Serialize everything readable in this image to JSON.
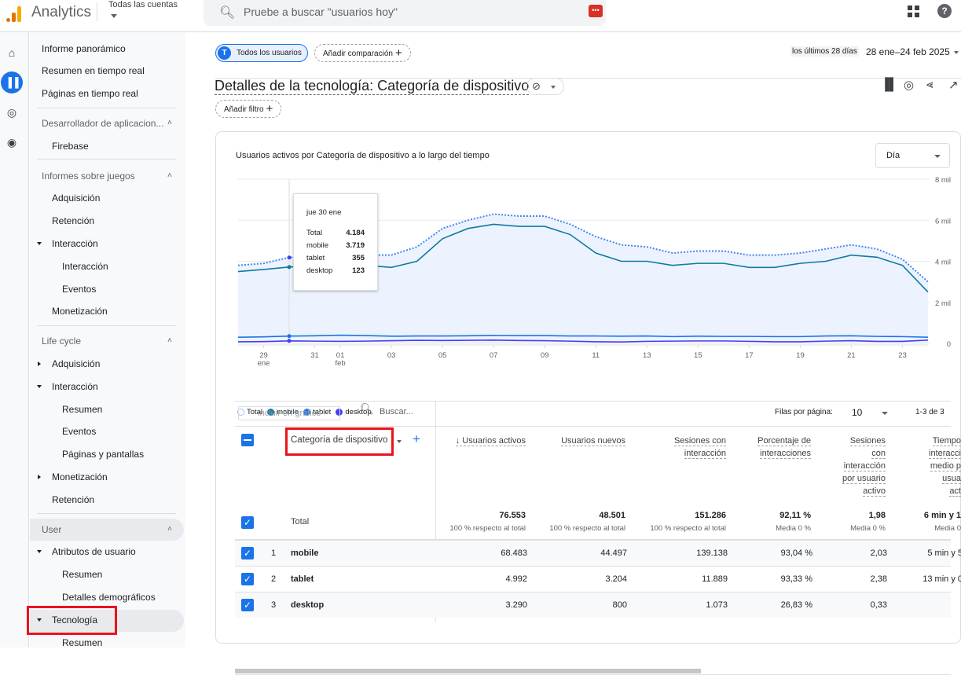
{
  "header": {
    "app_name": "Analytics",
    "account_selector": "Todas las cuentas",
    "search_placeholder": "Pruebe a buscar \"usuarios hoy\"",
    "icons": [
      "analytics-logo-icon",
      "search-icon",
      "keyboard-shortcut-icon",
      "apps-grid-icon",
      "help-icon"
    ]
  },
  "rail": {
    "icons": [
      "home-icon",
      "reports-icon",
      "explore-icon",
      "advertising-icon"
    ]
  },
  "nav": {
    "top_items": [
      "Informe panorámico",
      "Resumen en tiempo real",
      "Páginas en tiempo real"
    ],
    "sections": [
      {
        "title": "Desarrollador de aplicacion...",
        "items": [
          "Firebase"
        ]
      },
      {
        "title": "Informes sobre juegos",
        "items": [
          "Adquisición",
          "Retención",
          "Interacción",
          "Interacción",
          "Eventos",
          "Monetización"
        ]
      },
      {
        "title": "Life cycle",
        "items": [
          "Adquisición",
          "Interacción",
          "Resumen",
          "Eventos",
          "Páginas y pantallas",
          "Monetización",
          "Retención"
        ]
      },
      {
        "title": "User",
        "items": [
          "Atributos de usuario",
          "Resumen",
          "Detalles demográficos",
          "Tecnología",
          "Resumen"
        ]
      }
    ]
  },
  "toolbar": {
    "segment_chip": "Todos los usuarios",
    "segment_avatar": "T",
    "add_comparison": "Añadir comparación",
    "date_label": "los últimos 28 días",
    "date_range": "28 ene–24 feb 2025",
    "page_title": "Detalles de la tecnología: Categoría de dispositivo",
    "add_filter": "Añadir filtro"
  },
  "chart_card": {
    "title": "Usuarios activos por Categoría de dispositivo a lo largo del tiempo",
    "granularity": "Día",
    "tooltip": {
      "date": "jue 30 ene",
      "rows": [
        {
          "label": "Total",
          "value": "4.184"
        },
        {
          "label": "mobile",
          "value": "3.719"
        },
        {
          "label": "tablet",
          "value": "355"
        },
        {
          "label": "desktop",
          "value": "123"
        }
      ]
    }
  },
  "chart_data": {
    "type": "line",
    "title": "Usuarios activos por Categoría de dispositivo a lo largo del tiempo",
    "xlabel": "",
    "ylabel": "",
    "ylim": [
      0,
      8000
    ],
    "y_ticks": [
      "0",
      "2 mil",
      "4 mil",
      "6 mil",
      "8 mil"
    ],
    "x_tick_labels": [
      {
        "day": 29,
        "label": "29",
        "sub": "ene"
      },
      {
        "day": 31,
        "label": "31",
        "sub": ""
      },
      {
        "day": 32,
        "label": "01",
        "sub": "feb"
      },
      {
        "day": 34,
        "label": "03",
        "sub": ""
      },
      {
        "day": 36,
        "label": "05",
        "sub": ""
      },
      {
        "day": 38,
        "label": "07",
        "sub": ""
      },
      {
        "day": 40,
        "label": "09",
        "sub": ""
      },
      {
        "day": 42,
        "label": "11",
        "sub": ""
      },
      {
        "day": 44,
        "label": "13",
        "sub": ""
      },
      {
        "day": 46,
        "label": "15",
        "sub": ""
      },
      {
        "day": 48,
        "label": "17",
        "sub": ""
      },
      {
        "day": 50,
        "label": "19",
        "sub": ""
      },
      {
        "day": 52,
        "label": "21",
        "sub": ""
      },
      {
        "day": 54,
        "label": "23",
        "sub": ""
      }
    ],
    "x": [
      28,
      29,
      30,
      31,
      32,
      33,
      34,
      35,
      36,
      37,
      38,
      39,
      40,
      41,
      42,
      43,
      44,
      45,
      46,
      47,
      48,
      49,
      50,
      51,
      52,
      53,
      54,
      55
    ],
    "grid": true,
    "legend": "bottom-left",
    "highlight_day": 30,
    "series": [
      {
        "name": "Total",
        "color": "#4285f4",
        "style": "dotted",
        "values": [
          3800,
          3900,
          4184,
          4200,
          4200,
          4300,
          4300,
          4700,
          5600,
          6000,
          6300,
          6200,
          6200,
          5800,
          5200,
          4800,
          4700,
          4400,
          4500,
          4500,
          4300,
          4300,
          4400,
          4600,
          4800,
          4600,
          4100,
          3000
        ]
      },
      {
        "name": "mobile",
        "color": "#1a73e8",
        "stroke": "#12799f",
        "style": "solid",
        "values": [
          3500,
          3600,
          3719,
          3800,
          3800,
          3800,
          3700,
          4000,
          5100,
          5600,
          5800,
          5700,
          5700,
          5300,
          4400,
          4000,
          4000,
          3800,
          3900,
          3900,
          3700,
          3700,
          3900,
          4000,
          4300,
          4200,
          3800,
          2500
        ]
      },
      {
        "name": "tablet",
        "color": "#1a73e8",
        "style": "solid",
        "values": [
          300,
          320,
          355,
          370,
          400,
          380,
          350,
          360,
          360,
          370,
          390,
          380,
          380,
          360,
          360,
          350,
          360,
          330,
          350,
          340,
          340,
          330,
          330,
          360,
          370,
          340,
          330,
          300
        ]
      },
      {
        "name": "desktop",
        "color": "#4a3df0",
        "style": "solid",
        "values": [
          80,
          90,
          123,
          110,
          100,
          110,
          130,
          150,
          140,
          150,
          160,
          140,
          130,
          110,
          80,
          70,
          100,
          110,
          120,
          120,
          100,
          80,
          80,
          110,
          130,
          100,
          100,
          160
        ]
      }
    ]
  },
  "legend": [
    {
      "label": "Total",
      "color": "#4285f4",
      "hollow": true
    },
    {
      "label": "mobile",
      "color": "#12799f"
    },
    {
      "label": "tablet",
      "color": "#1a73e8"
    },
    {
      "label": "desktop",
      "color": "#4a3df0"
    }
  ],
  "table": {
    "include_in_chart": "Incluir en gráfico",
    "search_placeholder": "Buscar...",
    "rows_per_page_label": "Filas por página:",
    "rows_per_page": "10",
    "pagination": "1-3 de 3",
    "dimension_header": "Categoría de dispositivo",
    "columns": [
      [
        "↓ Usuarios activos"
      ],
      [
        "Usuarios nuevos"
      ],
      [
        "Sesiones con",
        "interacción"
      ],
      [
        "Porcentaje de",
        "interacciones"
      ],
      [
        "Sesiones",
        "con",
        "interacción",
        "por usuario",
        "activo"
      ],
      [
        "Tiempo",
        "interacci",
        "medio p",
        "usua",
        "act"
      ]
    ],
    "total": {
      "label": "Total",
      "values": [
        "76.553",
        "48.501",
        "151.286",
        "92,11 %",
        "1,98",
        "6 min y 1"
      ],
      "sub": [
        "100 % respecto al total",
        "100 % respecto al total",
        "100 % respecto al total",
        "Media 0 %",
        "Media 0 %",
        "Media 0"
      ]
    },
    "rows": [
      {
        "index": "1",
        "name": "mobile",
        "values": [
          "68.483",
          "44.497",
          "139.138",
          "93,04 %",
          "2,03",
          "5 min y 5"
        ]
      },
      {
        "index": "2",
        "name": "tablet",
        "values": [
          "4.992",
          "3.204",
          "11.889",
          "93,33 %",
          "2,38",
          "13 min y 0"
        ]
      },
      {
        "index": "3",
        "name": "desktop",
        "values": [
          "3.290",
          "800",
          "1.073",
          "26,83 %",
          "0,33",
          ""
        ]
      }
    ]
  }
}
